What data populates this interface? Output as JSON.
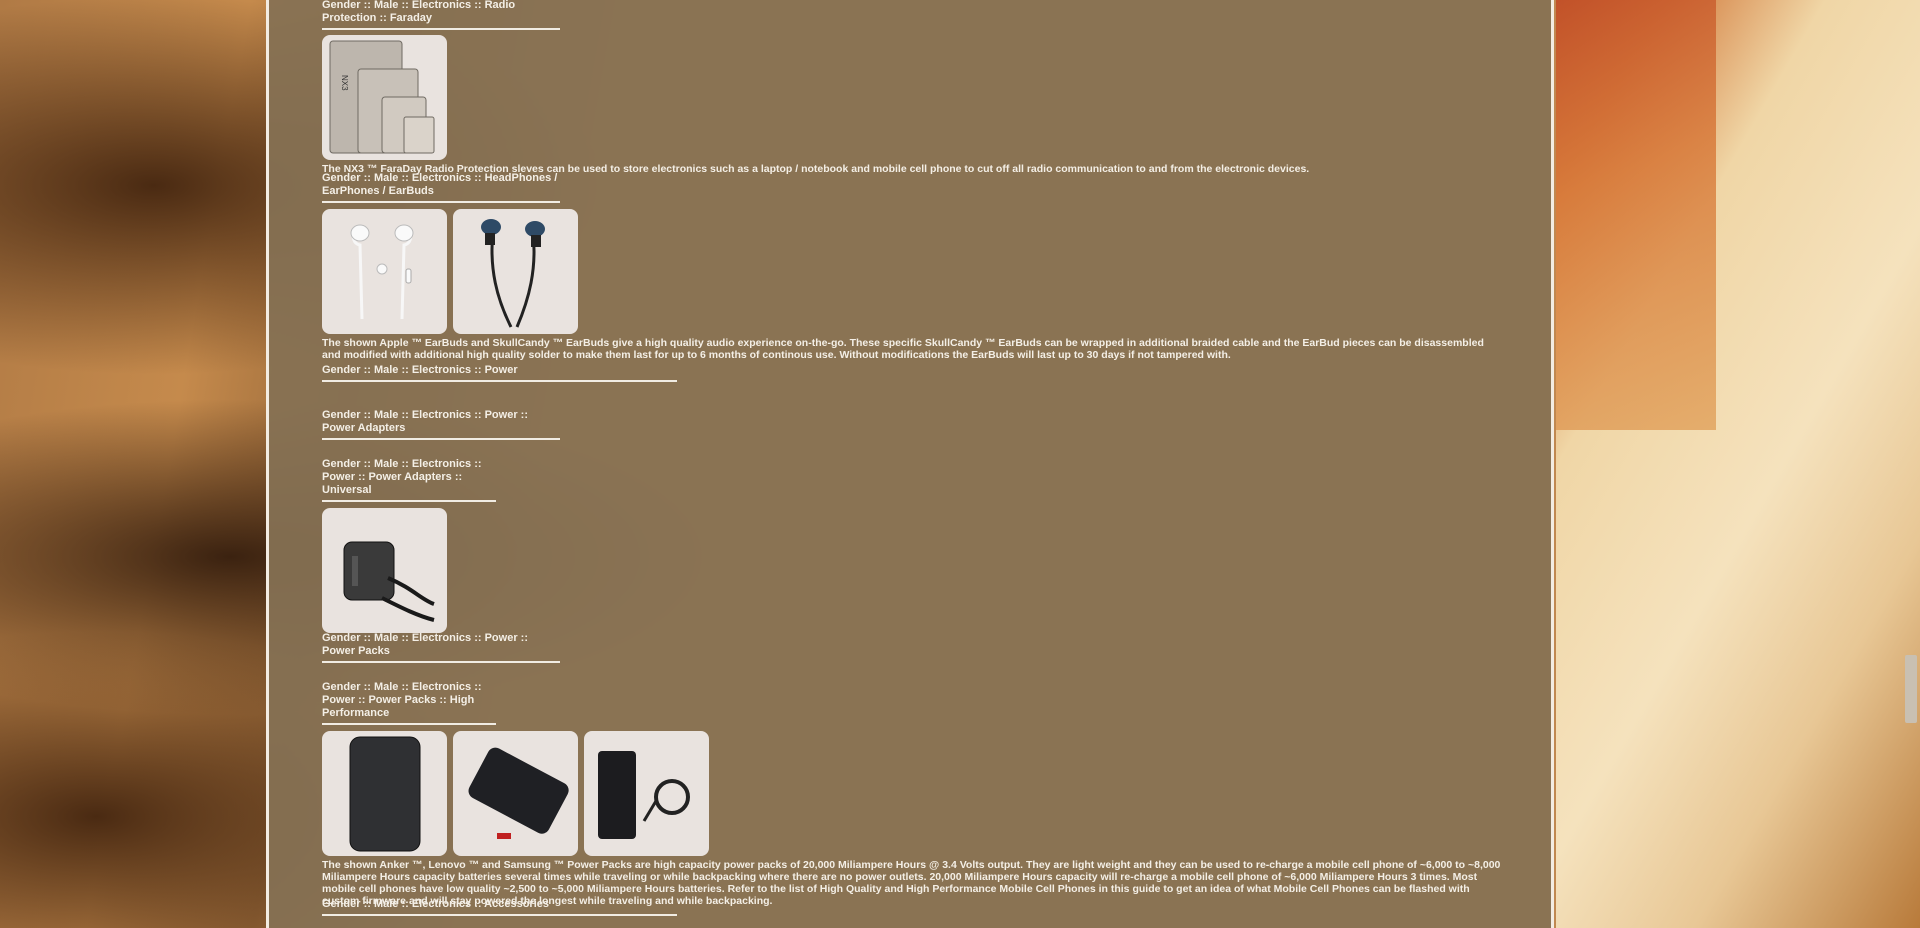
{
  "sections": [
    {
      "heading": "Gender :: Male :: Electronics :: Radio Protection :: Faraday",
      "images": [
        "faraday-bags"
      ],
      "description": "The NX3 ™ FaraDay Radio Protection sleves can be used to store electronics such as a laptop / notebook and mobile cell phone to cut off all radio communication to and from the electronic devices."
    },
    {
      "heading": "Gender :: Male :: Electronics :: HeadPhones / EarPhones / EarBuds",
      "images": [
        "apple-earbuds",
        "skullcandy-earbuds"
      ],
      "description": "The shown Apple ™ EarBuds and SkullCandy ™ EarBuds give a high quality audio experience on-the-go. These specific SkullCandy ™ EarBuds can be wrapped in additional braided cable and the EarBud pieces can be disassembled and modified with additional high quality solder to make them last for up to 6 months of continous use. Without modifications the EarBuds will last up to 30 days if not tampered with."
    },
    {
      "heading": "Gender :: Male :: Electronics :: Power"
    },
    {
      "heading": "Gender :: Male :: Electronics :: Power :: Power Adapters"
    },
    {
      "heading": "Gender :: Male :: Electronics :: Power :: Power Adapters :: Universal",
      "images": [
        "universal-power-adapter"
      ]
    },
    {
      "heading": "Gender :: Male :: Electronics :: Power :: Power Packs"
    },
    {
      "heading": "Gender :: Male :: Electronics :: Power :: Power Packs :: High Performance",
      "images": [
        "anker-power-pack",
        "lenovo-power-pack",
        "samsung-power-pack"
      ],
      "description": "The shown Anker ™, Lenovo ™ and Samsung ™ Power Packs are high capacity power packs of 20,000 Miliampere Hours @ 3.4 Volts output. They are light weight and they can be used to re-charge a mobile cell phone of ~6,000 to ~8,000 Miliampere Hours capacity batteries several times while traveling or while backpacking where there are no power outlets. 20,000 Miliampere Hours capacity will re-charge a mobile cell phone of ~6,000 Miliampere Hours 3 times. Most mobile cell phones have low quality ~2,500 to ~5,000 Miliampere Hours batteries. Refer to the list of High Quality and High Performance Mobile Cell Phones in this guide to get an idea of what Mobile Cell Phones can be flashed with custom firmware and will stay powered the longest while traveling and while backpacking."
    },
    {
      "heading": "Gender :: Male :: Electronics :: Accessories"
    }
  ]
}
